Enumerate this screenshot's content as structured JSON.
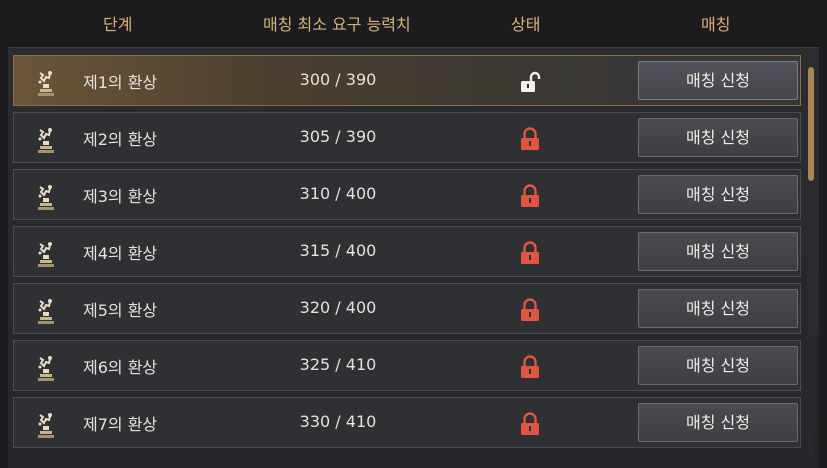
{
  "header": {
    "stage": "단계",
    "min_power": "매칭 최소 요구 능력치",
    "status": "상태",
    "matching": "매칭"
  },
  "colors": {
    "accent": "#d9b278",
    "locked": "#e0553f",
    "unlocked": "#f2f2f2"
  },
  "rows": [
    {
      "name": "제1의 환상",
      "power": "300 / 390",
      "status": "unlocked",
      "button": "매칭 신청"
    },
    {
      "name": "제2의 환상",
      "power": "305 / 390",
      "status": "locked",
      "button": "매칭 신청"
    },
    {
      "name": "제3의 환상",
      "power": "310 / 400",
      "status": "locked",
      "button": "매칭 신청"
    },
    {
      "name": "제4의 환상",
      "power": "315 / 400",
      "status": "locked",
      "button": "매칭 신청"
    },
    {
      "name": "제5의 환상",
      "power": "320 / 400",
      "status": "locked",
      "button": "매칭 신청"
    },
    {
      "name": "제6의 환상",
      "power": "325 / 410",
      "status": "locked",
      "button": "매칭 신청"
    },
    {
      "name": "제7의 환상",
      "power": "330 / 410",
      "status": "locked",
      "button": "매칭 신청"
    }
  ]
}
